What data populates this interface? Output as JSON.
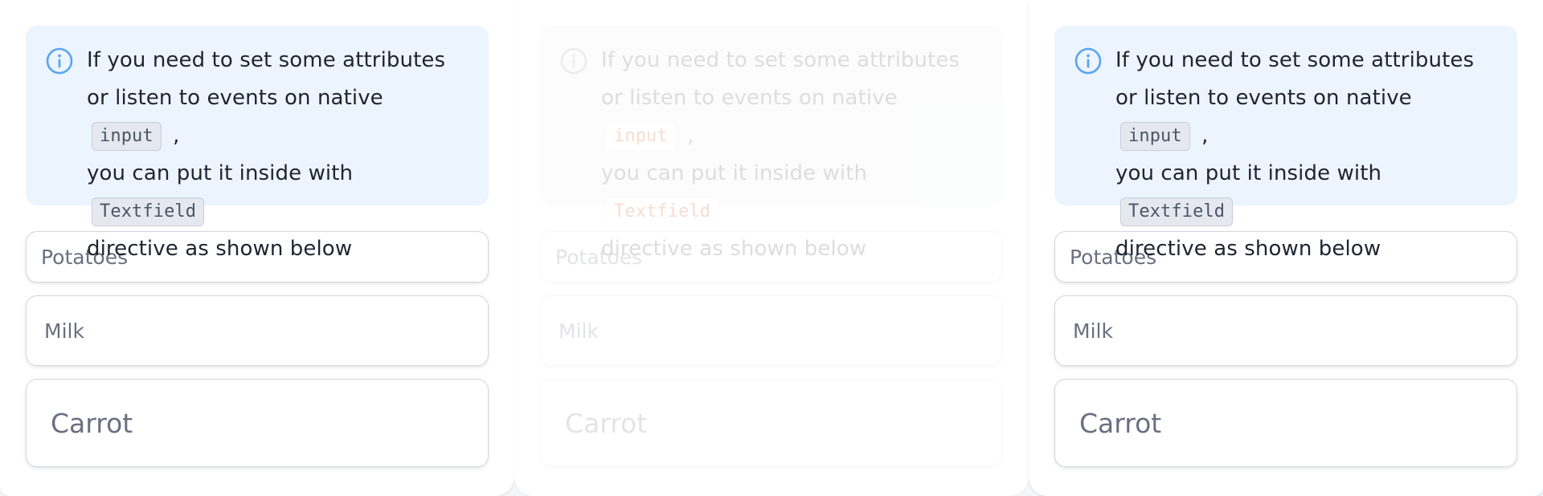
{
  "panels": [
    {
      "info": {
        "text_1": "If you need to set some attributes or listen to events on native",
        "code_1": "input",
        "text_2": ",",
        "text_3": "you can put it inside with",
        "code_2": "Textfield",
        "text_4": "directive as shown below"
      },
      "fields": [
        {
          "placeholder": "Potatoes"
        },
        {
          "placeholder": "Milk"
        },
        {
          "placeholder": "Carrot"
        }
      ]
    },
    {
      "info": {
        "text_1": "If you need to set some attributes or listen to events on native",
        "code_1": "input",
        "text_2": ",",
        "text_3": "you can put it inside with",
        "code_2": "Textfield",
        "text_4": "directive as shown below"
      },
      "fields": [
        {
          "placeholder": "Potatoes"
        },
        {
          "placeholder": "Milk"
        },
        {
          "placeholder": "Carrot"
        }
      ]
    },
    {
      "info": {
        "text_1": "If you need to set some attributes or listen to events on native",
        "code_1": "input",
        "text_2": ",",
        "text_3": "you can put it inside with",
        "code_2": "Textfield",
        "text_4": "directive as shown below"
      },
      "fields": [
        {
          "placeholder": "Potatoes"
        },
        {
          "placeholder": "Milk"
        },
        {
          "placeholder": "Carrot"
        }
      ]
    }
  ],
  "icons": {
    "info": "info-circle-icon"
  },
  "colors": {
    "info_background": "#ecf4fd",
    "info_icon": "#5aa5f0",
    "code_accent_faded": "#d24a00"
  }
}
